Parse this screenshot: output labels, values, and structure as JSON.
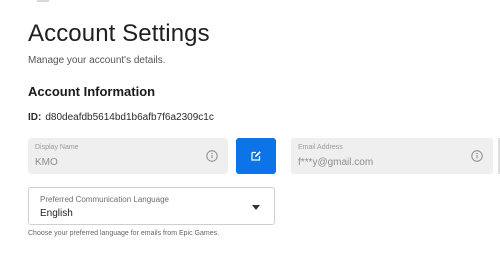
{
  "header": {
    "title": "Account Settings",
    "subtitle": "Manage your account's details."
  },
  "account_info": {
    "heading": "Account Information",
    "id_label": "ID:",
    "id_value": "d80deafdb5614bd1b6afb7f6a2309c1c"
  },
  "display_name": {
    "label": "Display Name",
    "value": "KMO",
    "icon": "info-icon"
  },
  "edit_button": {
    "icon": "edit-icon",
    "color": "#0d74e7"
  },
  "email": {
    "label": "Email Address",
    "value": "f***y@gmail.com",
    "icon": "info-icon"
  },
  "language": {
    "label": "Preferred Communication Language",
    "value": "English",
    "helper": "Choose your preferred language for emails from Epic Games."
  }
}
